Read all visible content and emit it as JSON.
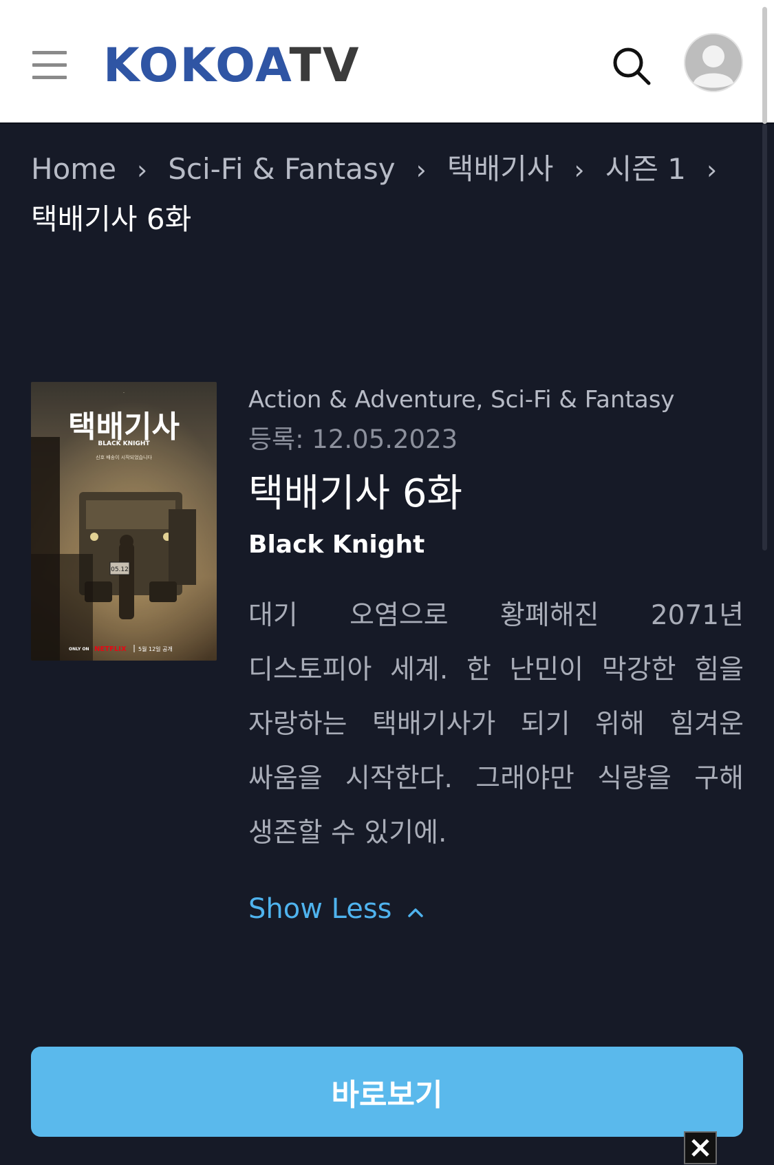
{
  "header": {
    "logo_koko": "KOKO",
    "logo_a": "A",
    "logo_tv": "TV"
  },
  "breadcrumb": {
    "home": "Home",
    "genre": "Sci-Fi & Fantasy",
    "series": "택배기사",
    "season": "시즌 1",
    "current": "택배기사 6화"
  },
  "poster": {
    "title_ko": "택배기사",
    "title_en": "BLACK KNIGHT",
    "tagline": "신호 배송이 시작되었습니다",
    "only_on": "ONLY ON",
    "brand": "NETFLIX",
    "release": "5월 12일 공개",
    "plate": "05.12"
  },
  "details": {
    "genres": "Action & Adventure, Sci-Fi & Fantasy",
    "date": "등록: 12.05.2023",
    "title": "택배기사 6화",
    "subtitle": "Black Knight",
    "description": "대기 오염으로 황폐해진 2071년 디스토피아 세계. 한 난민이 막강한 힘을 자랑하는 택배기사가 되기 위해 힘겨운 싸움을 시작한다. 그래야만 식량을 구해 생존할 수 있기에.",
    "show_less": "Show Less"
  },
  "actions": {
    "watch": "바로보기"
  },
  "colors": {
    "background": "#161a27",
    "accent": "#5ab9ec",
    "link": "#4fb3ee",
    "logo_blue": "#2f55a4"
  }
}
